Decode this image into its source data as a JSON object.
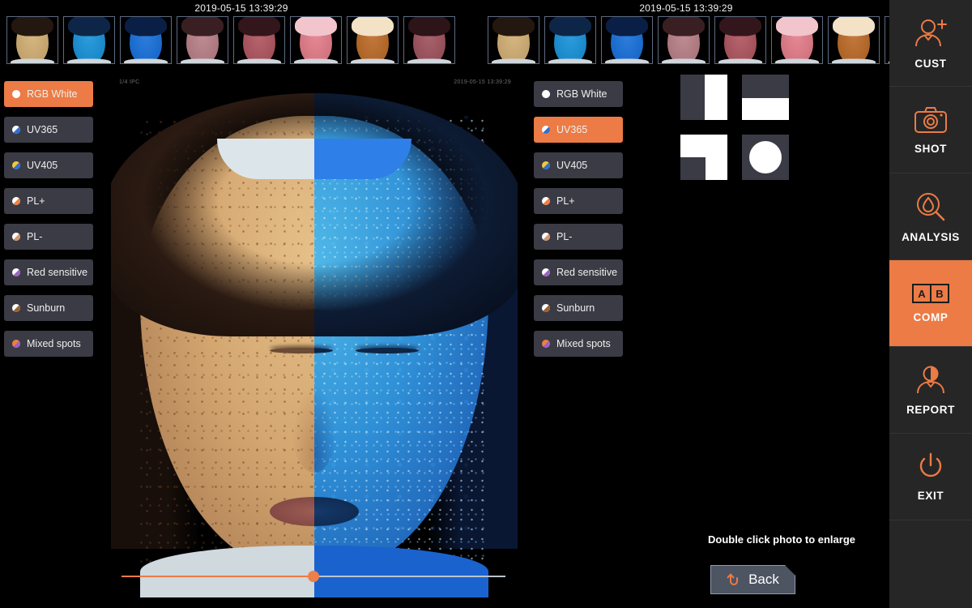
{
  "strips": [
    {
      "name": "left-thumbnail-strip",
      "timestamp": "2019-05-15 13:39:29",
      "thumbnails": [
        {
          "label": "RGB White",
          "skin": "#d8b882",
          "hair": "#241710",
          "tint": "rgba(216,184,130,0)"
        },
        {
          "label": "UV365",
          "skin": "#2f9ede",
          "hair": "#0d2648",
          "tint": "rgba(47,158,222,0)"
        },
        {
          "label": "UV405",
          "skin": "#2f7fe0",
          "hair": "#0a1f45",
          "tint": "rgba(47,127,224,0)"
        },
        {
          "label": "PL+",
          "skin": "#c08d94",
          "hair": "#3a1f22",
          "tint": "rgba(192,141,148,0)"
        },
        {
          "label": "PL-",
          "skin": "#b8666f",
          "hair": "#33161c",
          "tint": "rgba(184,102,111,0)"
        },
        {
          "label": "Red sensitive",
          "skin": "#e88a96",
          "hair": "#f2c5cc",
          "tint": "rgba(232,138,150,0)"
        },
        {
          "label": "Sunburn",
          "skin": "#c47a3c",
          "hair": "#f3e2c6",
          "tint": "rgba(196,122,60,0)"
        },
        {
          "label": "Mixed spots",
          "skin": "#a9646e",
          "hair": "#2c1418",
          "tint": "rgba(169,100,110,0)"
        }
      ]
    },
    {
      "name": "right-thumbnail-strip",
      "timestamp": "2019-05-15 13:39:29",
      "thumbnails": [
        {
          "label": "RGB White",
          "skin": "#d8b882",
          "hair": "#241710",
          "tint": "rgba(216,184,130,0)"
        },
        {
          "label": "UV365",
          "skin": "#2f9ede",
          "hair": "#0d2648",
          "tint": "rgba(47,158,222,0)"
        },
        {
          "label": "UV405",
          "skin": "#2f7fe0",
          "hair": "#0a1f45",
          "tint": "rgba(47,127,224,0)"
        },
        {
          "label": "PL+",
          "skin": "#c08d94",
          "hair": "#3a1f22",
          "tint": "rgba(192,141,148,0)"
        },
        {
          "label": "PL-",
          "skin": "#b8666f",
          "hair": "#33161c",
          "tint": "rgba(184,102,111,0)"
        },
        {
          "label": "Red sensitive",
          "skin": "#e88a96",
          "hair": "#f2c5cc",
          "tint": "rgba(232,138,150,0)"
        },
        {
          "label": "Sunburn",
          "skin": "#c47a3c",
          "hair": "#f3e2c6",
          "tint": "rgba(196,122,60,0)"
        },
        {
          "label": "Mixed spots",
          "skin": "#a9646e",
          "hair": "#2c1418",
          "tint": "rgba(169,100,110,0)"
        }
      ]
    }
  ],
  "mode_lists": [
    {
      "name": "left-mode-list",
      "selected": "RGB White",
      "items": [
        {
          "label": "RGB White",
          "dot_a": "#ffffff",
          "dot_b": "#ffffff"
        },
        {
          "label": "UV365",
          "dot_a": "#ffffff",
          "dot_b": "#2f6fd0"
        },
        {
          "label": "UV405",
          "dot_a": "#f2c83c",
          "dot_b": "#2f6fd0"
        },
        {
          "label": "PL+",
          "dot_a": "#ffffff",
          "dot_b": "#ef8040"
        },
        {
          "label": "PL-",
          "dot_a": "#ffffff",
          "dot_b": "#d09a6e"
        },
        {
          "label": "Red sensitive",
          "dot_a": "#ffffff",
          "dot_b": "#9b63c4"
        },
        {
          "label": "Sunburn",
          "dot_a": "#ffffff",
          "dot_b": "#9b6130"
        },
        {
          "label": "Mixed spots",
          "dot_a": "#ef8040",
          "dot_b": "#9b63c4"
        }
      ]
    },
    {
      "name": "right-mode-list",
      "selected": "UV365",
      "items": [
        {
          "label": "RGB White",
          "dot_a": "#ffffff",
          "dot_b": "#ffffff"
        },
        {
          "label": "UV365",
          "dot_a": "#ffffff",
          "dot_b": "#2f6fd0"
        },
        {
          "label": "UV405",
          "dot_a": "#f2c83c",
          "dot_b": "#2f6fd0"
        },
        {
          "label": "PL+",
          "dot_a": "#ffffff",
          "dot_b": "#ef8040"
        },
        {
          "label": "PL-",
          "dot_a": "#ffffff",
          "dot_b": "#d09a6e"
        },
        {
          "label": "Red sensitive",
          "dot_a": "#ffffff",
          "dot_b": "#9b63c4"
        },
        {
          "label": "Sunburn",
          "dot_a": "#ffffff",
          "dot_b": "#9b6130"
        },
        {
          "label": "Mixed spots",
          "dot_a": "#ef8040",
          "dot_b": "#9b63c4"
        }
      ]
    }
  ],
  "photo": {
    "left_mode": "RGB White",
    "right_mode": "UV365",
    "overlay_left": "1/4 IPC",
    "overlay_right": "2019-05-15 13:39:29",
    "split_percent": 50,
    "slider_value": 50
  },
  "layout_modes": [
    {
      "name": "vertical-split",
      "icon": "split-vertical-icon"
    },
    {
      "name": "horizontal-split",
      "icon": "split-horizontal-icon"
    },
    {
      "name": "corner-split",
      "icon": "split-corner-icon"
    },
    {
      "name": "circle-overlay",
      "icon": "circle-overlay-icon"
    }
  ],
  "hint": "Double click photo to enlarge",
  "back_button": {
    "label": "Back",
    "icon": "back-arrow-icon"
  },
  "right_nav": {
    "active": "COMP",
    "items": [
      {
        "label": "CUST",
        "icon": "add-user-icon"
      },
      {
        "label": "SHOT",
        "icon": "camera-icon"
      },
      {
        "label": "ANALYSIS",
        "icon": "droplet-magnifier-icon"
      },
      {
        "label": "COMP",
        "icon": "ab-compare-icon"
      },
      {
        "label": "REPORT",
        "icon": "half-face-person-icon"
      },
      {
        "label": "EXIT",
        "icon": "power-icon"
      }
    ]
  },
  "colors": {
    "accent": "#ec7b45",
    "panel": "#3b3b45",
    "nav_bg": "#262626",
    "background": "#000000"
  }
}
